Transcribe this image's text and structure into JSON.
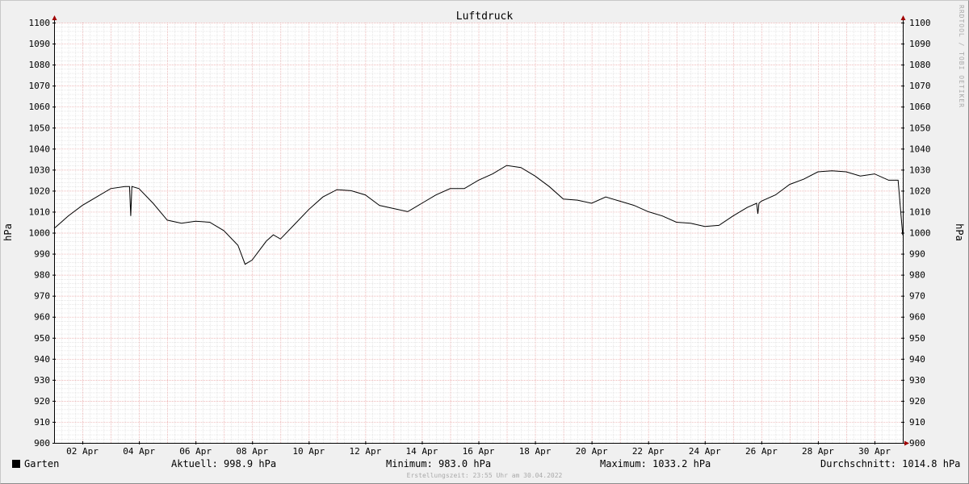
{
  "chart_data": {
    "type": "line",
    "title": "Luftdruck",
    "ylabel": "hPa",
    "ylabel_right": "hPa",
    "ylim": [
      900,
      1100
    ],
    "yticks": [
      900,
      910,
      920,
      930,
      940,
      950,
      960,
      970,
      980,
      990,
      1000,
      1010,
      1020,
      1030,
      1040,
      1050,
      1060,
      1070,
      1080,
      1090,
      1100
    ],
    "xlim": [
      "2022-04-01 00:00",
      "2022-05-01 00:00"
    ],
    "xticks": [
      "02 Apr",
      "04 Apr",
      "06 Apr",
      "08 Apr",
      "10 Apr",
      "12 Apr",
      "14 Apr",
      "16 Apr",
      "18 Apr",
      "20 Apr",
      "22 Apr",
      "24 Apr",
      "26 Apr",
      "28 Apr",
      "30 Apr"
    ],
    "grid": true,
    "series": [
      {
        "name": "Garten",
        "color": "#000000",
        "x": [
          "2022-04-01 00:00",
          "2022-04-01 06:00",
          "2022-04-01 12:00",
          "2022-04-02 00:00",
          "2022-04-02 12:00",
          "2022-04-03 00:00",
          "2022-04-03 12:00",
          "2022-04-03 16:00",
          "2022-04-03 17:00",
          "2022-04-03 18:00",
          "2022-04-04 00:00",
          "2022-04-04 12:00",
          "2022-04-05 00:00",
          "2022-04-05 12:00",
          "2022-04-06 00:00",
          "2022-04-06 12:00",
          "2022-04-07 00:00",
          "2022-04-07 12:00",
          "2022-04-07 18:00",
          "2022-04-08 00:00",
          "2022-04-08 12:00",
          "2022-04-08 18:00",
          "2022-04-09 00:00",
          "2022-04-09 12:00",
          "2022-04-10 00:00",
          "2022-04-10 12:00",
          "2022-04-11 00:00",
          "2022-04-11 12:00",
          "2022-04-12 00:00",
          "2022-04-12 12:00",
          "2022-04-13 00:00",
          "2022-04-13 12:00",
          "2022-04-14 00:00",
          "2022-04-14 12:00",
          "2022-04-15 00:00",
          "2022-04-15 12:00",
          "2022-04-16 00:00",
          "2022-04-16 12:00",
          "2022-04-17 00:00",
          "2022-04-17 12:00",
          "2022-04-18 00:00",
          "2022-04-18 12:00",
          "2022-04-19 00:00",
          "2022-04-19 12:00",
          "2022-04-20 00:00",
          "2022-04-20 12:00",
          "2022-04-21 00:00",
          "2022-04-21 12:00",
          "2022-04-22 00:00",
          "2022-04-22 12:00",
          "2022-04-23 00:00",
          "2022-04-23 12:00",
          "2022-04-24 00:00",
          "2022-04-24 12:00",
          "2022-04-25 00:00",
          "2022-04-25 12:00",
          "2022-04-25 20:00",
          "2022-04-25 21:00",
          "2022-04-25 22:00",
          "2022-04-26 00:00",
          "2022-04-26 12:00",
          "2022-04-27 00:00",
          "2022-04-27 12:00",
          "2022-04-28 00:00",
          "2022-04-28 12:00",
          "2022-04-29 00:00",
          "2022-04-29 12:00",
          "2022-04-30 00:00",
          "2022-04-30 12:00",
          "2022-04-30 20:00",
          "2022-04-30 23:55"
        ],
        "values": [
          1002,
          1005,
          1008,
          1013,
          1017,
          1021,
          1022,
          1022,
          1008,
          1022,
          1021,
          1014,
          1006,
          1004.5,
          1005.5,
          1005,
          1001,
          994,
          985,
          987,
          996,
          999,
          997,
          1004,
          1011,
          1017,
          1020.5,
          1020,
          1018,
          1013,
          1011.5,
          1010,
          1014,
          1018,
          1021,
          1021,
          1025,
          1028,
          1032,
          1031,
          1027,
          1022,
          1016,
          1015.5,
          1014,
          1017,
          1015,
          1013,
          1010,
          1008,
          1005,
          1004.5,
          1003,
          1003.5,
          1008,
          1012,
          1014,
          1009,
          1014,
          1015,
          1018,
          1023,
          1025.5,
          1029,
          1029.5,
          1029,
          1027,
          1028,
          1025,
          1025,
          998.9
        ]
      }
    ]
  },
  "legend": {
    "series_label": "Garten",
    "current": "Aktuell: 998.9 hPa",
    "minimum": "Minimum: 983.0 hPa",
    "maximum": "Maximum: 1033.2 hPa",
    "average": "Durchschnitt: 1014.8 hPa"
  },
  "footer": "Erstellungszeit: 23:55 Uhr am 30.04.2022",
  "watermark": "RRDTOOL / TOBI OETIKER"
}
